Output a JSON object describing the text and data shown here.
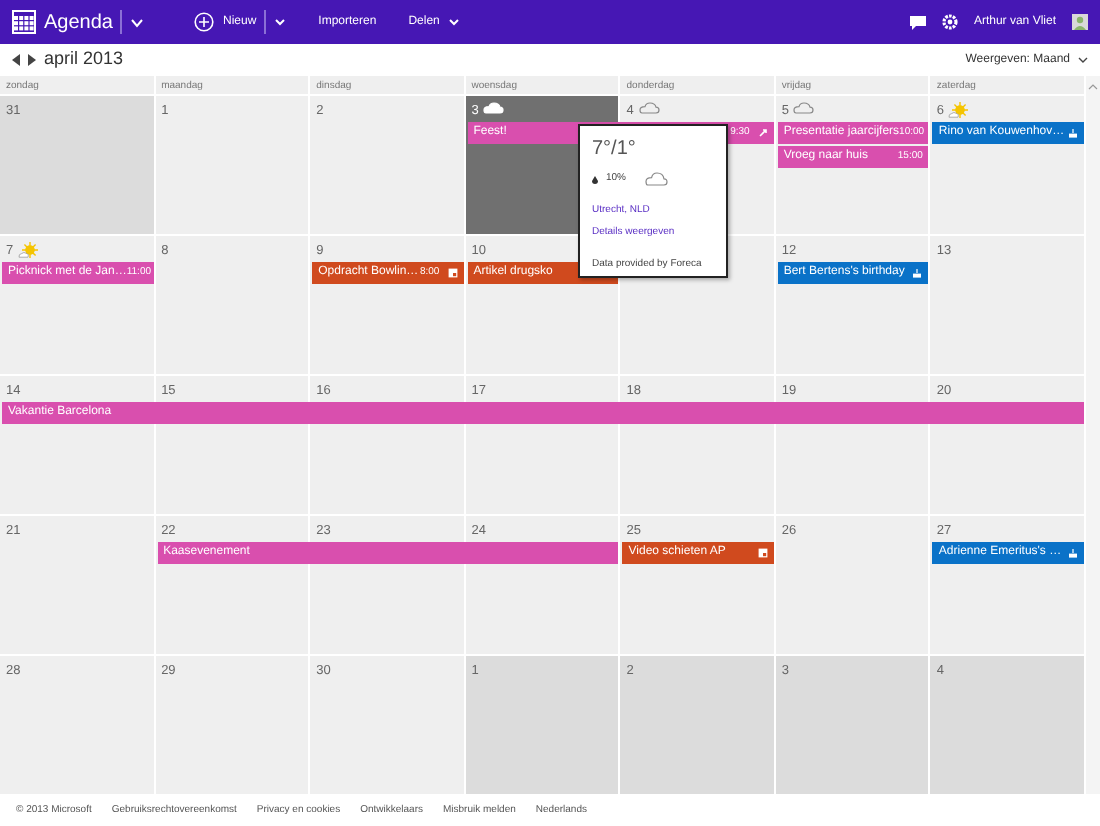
{
  "app_bar": {
    "title": "Agenda",
    "new_label": "Nieuw",
    "import_label": "Importeren",
    "share_label": "Delen",
    "user_name": "Arthur van Vliet"
  },
  "toolbar": {
    "month": "april 2013",
    "view_label": "Weergeven: Maand"
  },
  "weekdays": [
    "zondag",
    "maandag",
    "dinsdag",
    "woensdag",
    "donderdag",
    "vrijdag",
    "zaterdag"
  ],
  "weeks": [
    {
      "days": [
        {
          "number": "31",
          "other_month": true,
          "selected": false
        },
        {
          "number": "1",
          "other_month": false,
          "selected": false
        },
        {
          "number": "2",
          "other_month": false,
          "selected": false
        },
        {
          "number": "3",
          "other_month": false,
          "selected": true,
          "weather": {
            "kind": "cloudy"
          },
          "events": [
            {
              "title": "Feest!",
              "time": "9:30",
              "kind": "link",
              "color": "#d94fae"
            }
          ]
        },
        {
          "number": "4",
          "other_month": false,
          "selected": false,
          "weather": {
            "kind": "cloudy"
          },
          "events": [
            {
              "continued": true
            }
          ]
        },
        {
          "number": "5",
          "other_month": false,
          "selected": false,
          "weather": {
            "kind": "cloudy"
          },
          "events": [
            {
              "title": "Presentatie jaarcijfers",
              "time": "10:00",
              "color": "#d94fae"
            },
            {
              "title": "Vroeg naar huis",
              "time": "15:00",
              "color": "#d94fae"
            }
          ]
        },
        {
          "number": "6",
          "other_month": false,
          "selected": false,
          "weather": {
            "kind": "sunny"
          },
          "events": [
            {
              "title": "Rino van Kouwenhov…",
              "kind": "birthday",
              "color": "#0a72c8"
            }
          ]
        }
      ]
    },
    {
      "days": [
        {
          "number": "7",
          "other_month": false,
          "selected": false,
          "weather": {
            "kind": "sunny"
          },
          "events": [
            {
              "title": "Picknick met de Jan…",
              "time": "11:00",
              "color": "#d94fae"
            }
          ]
        },
        {
          "number": "8",
          "other_month": false,
          "selected": false
        },
        {
          "number": "9",
          "other_month": false,
          "selected": false,
          "events": [
            {
              "title": "Opdracht Bowlin…",
              "time": "8:00",
              "kind": "task",
              "color": "#d04a1e"
            }
          ]
        },
        {
          "number": "10",
          "other_month": false,
          "selected": false,
          "events": [
            {
              "title": "Artikel drugsko",
              "color": "#d04a1e"
            }
          ]
        },
        {
          "other_month": false,
          "selected": false
        },
        {
          "number": "12",
          "other_month": false,
          "selected": false,
          "events": [
            {
              "title": "Bert Bertens's birthday",
              "kind": "birthday",
              "color": "#0a72c8"
            }
          ]
        },
        {
          "number": "13",
          "other_month": false,
          "selected": false
        }
      ]
    },
    {
      "days": [
        {
          "number": "14",
          "other_month": false,
          "selected": false,
          "events": [
            {
              "title": "Vakantie Barcelona",
              "color": "#d94fae"
            }
          ]
        },
        {
          "number": "15",
          "other_month": false,
          "selected": false,
          "events": [
            {
              "continued": true
            }
          ]
        },
        {
          "number": "16",
          "other_month": false,
          "selected": false,
          "events": [
            {
              "continued": true
            }
          ]
        },
        {
          "number": "17",
          "other_month": false,
          "selected": false,
          "events": [
            {
              "continued": true
            }
          ]
        },
        {
          "number": "18",
          "other_month": false,
          "selected": false,
          "events": [
            {
              "continued": true
            }
          ]
        },
        {
          "number": "19",
          "other_month": false,
          "selected": false,
          "events": [
            {
              "continued": true
            }
          ]
        },
        {
          "number": "20",
          "other_month": false,
          "selected": false,
          "events": [
            {
              "continued": true
            }
          ]
        }
      ]
    },
    {
      "days": [
        {
          "number": "21",
          "other_month": false,
          "selected": false
        },
        {
          "number": "22",
          "other_month": false,
          "selected": false,
          "events": [
            {
              "title": "Kaasevenement",
              "color": "#d94fae"
            }
          ]
        },
        {
          "number": "23",
          "other_month": false,
          "selected": false,
          "events": [
            {
              "continued": true
            }
          ]
        },
        {
          "number": "24",
          "other_month": false,
          "selected": false,
          "events": [
            {
              "continued": true
            }
          ]
        },
        {
          "number": "25",
          "other_month": false,
          "selected": false,
          "events": [
            {
              "title": "Video schieten AP",
              "kind": "task",
              "color": "#d04a1e"
            }
          ]
        },
        {
          "number": "26",
          "other_month": false,
          "selected": false
        },
        {
          "number": "27",
          "other_month": false,
          "selected": false,
          "events": [
            {
              "title": "Adrienne Emeritus's …",
              "kind": "birthday",
              "color": "#0a72c8"
            }
          ]
        }
      ]
    },
    {
      "days": [
        {
          "number": "28",
          "other_month": false,
          "selected": false
        },
        {
          "number": "29",
          "other_month": false,
          "selected": false
        },
        {
          "number": "30",
          "other_month": false,
          "selected": false
        },
        {
          "number": "1",
          "other_month": true,
          "selected": false
        },
        {
          "number": "2",
          "other_month": true,
          "selected": false
        },
        {
          "number": "3",
          "other_month": true,
          "selected": false
        },
        {
          "number": "4",
          "other_month": true,
          "selected": false
        }
      ]
    }
  ],
  "weather_popup": {
    "temperature": "7°/1°",
    "precipitation": "10%",
    "location": "Utrecht, NLD",
    "details_link": "Details weergeven",
    "credit": "Data provided by Foreca"
  },
  "footer": [
    "© 2013 Microsoft",
    "Gebruiksrechtovereenkomst",
    "Privacy en cookies",
    "Ontwikkelaars",
    "Misbruik melden",
    "Nederlands"
  ]
}
